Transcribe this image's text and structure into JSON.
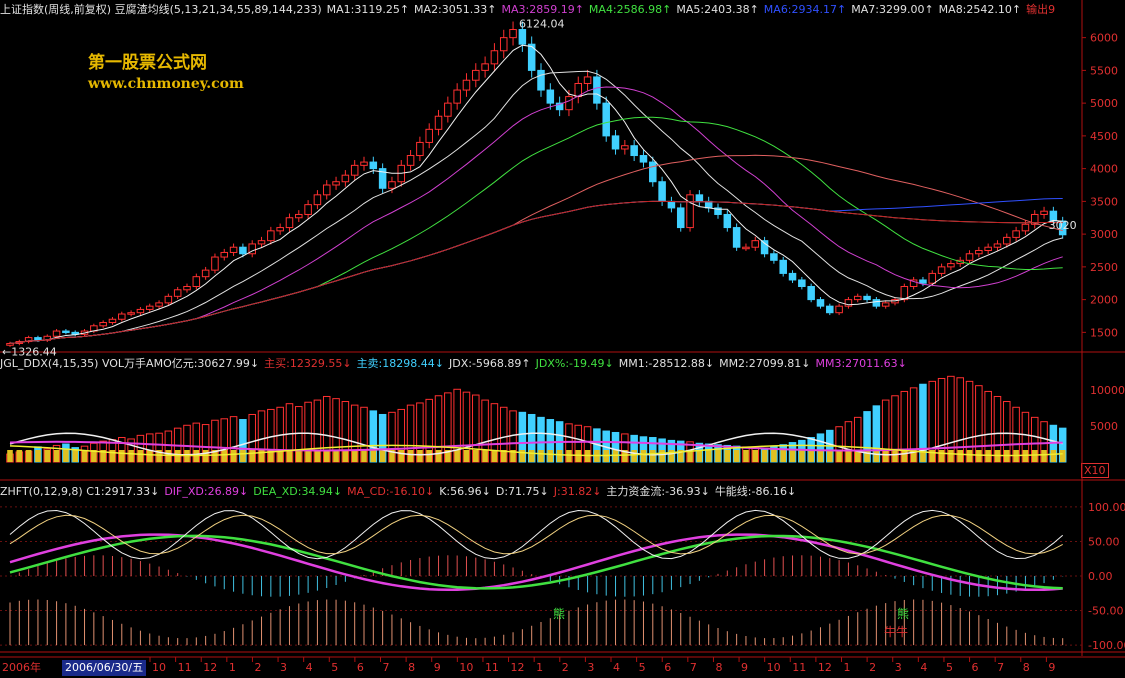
{
  "title_bar": {
    "items": [
      {
        "text": "上证指数(周线,前复权) 豆腐渣均线(5,13,21,34,55,89,144,233)",
        "color": "#e0e0e0"
      },
      {
        "text": "MA1:3119.25↑",
        "color": "#e0e0e0"
      },
      {
        "text": "MA2:3051.33↑",
        "color": "#e0e0e0"
      },
      {
        "text": "MA3:2859.19↑",
        "color": "#d040d0"
      },
      {
        "text": "MA4:2586.98↑",
        "color": "#40e040"
      },
      {
        "text": "MA5:2403.38↑",
        "color": "#e0e0e0"
      },
      {
        "text": "MA6:2934.17↑",
        "color": "#3050ff"
      },
      {
        "text": "MA7:3299.00↑",
        "color": "#e0e0e0"
      },
      {
        "text": "MA8:2542.10↑",
        "color": "#e0e0e0"
      },
      {
        "text": "输出9",
        "color": "#e03030"
      }
    ]
  },
  "watermark": {
    "line1": "第一股票公式网",
    "line2": "www.chnmoney.com"
  },
  "annotations": {
    "high": "6124.04",
    "low": "1326.44",
    "last": "3020"
  },
  "volume_bar": {
    "items": [
      {
        "text": "JGL_DDX(4,15,35) VOL万手AMO亿元:30627.99↓",
        "color": "#e0e0e0"
      },
      {
        "text": "主买:12329.55↓",
        "color": "#e03030"
      },
      {
        "text": "主卖:18298.44↓",
        "color": "#40d0ff"
      },
      {
        "text": "JDX:-5968.89↑",
        "color": "#e0e0e0"
      },
      {
        "text": "JDX%:-19.49↓",
        "color": "#40e040"
      },
      {
        "text": "MM1:-28512.88↓",
        "color": "#e0e0e0"
      },
      {
        "text": "MM2:27099.81↓",
        "color": "#e0e0e0"
      },
      {
        "text": "MM3:27011.63↓",
        "color": "#e040e0"
      }
    ]
  },
  "volume_scale": "X10",
  "indicator_bar": {
    "items": [
      {
        "text": "ZHFT(0,12,9,8) C1:2917.33↓",
        "color": "#e0e0e0"
      },
      {
        "text": "DIF_XD:26.89↓",
        "color": "#e040e0"
      },
      {
        "text": "DEA_XD:34.94↓",
        "color": "#40e040"
      },
      {
        "text": "MA_CD:-16.10↓",
        "color": "#e03030"
      },
      {
        "text": "K:56.96↓",
        "color": "#e0e0e0"
      },
      {
        "text": "D:71.75↓",
        "color": "#e0e0e0"
      },
      {
        "text": "J:31.82↓",
        "color": "#e03030"
      },
      {
        "text": "主力资金流:-36.93↓",
        "color": "#e0e0e0"
      },
      {
        "text": "牛能线:-86.16↓",
        "color": "#e0e0e0"
      }
    ]
  },
  "indicator_labels": {
    "bear1": "熊",
    "bear2": "熊",
    "bull": "牛牛"
  },
  "x_axis": {
    "year_label": "2006年",
    "cursor_date": "2006/06/30/五",
    "month_ticks": [
      "10",
      "11",
      "12",
      "1",
      "2",
      "3",
      "4",
      "5",
      "6",
      "7",
      "8",
      "9",
      "10",
      "11",
      "12",
      "1",
      "2",
      "3",
      "4",
      "5",
      "6",
      "7",
      "8",
      "9",
      "10",
      "11",
      "12",
      "1",
      "2",
      "3",
      "4",
      "5",
      "6",
      "7",
      "8",
      "9"
    ]
  },
  "chart_data": [
    {
      "type": "candlestick",
      "title": "上证指数(周线,前复权)",
      "ylim": [
        1200,
        6300
      ],
      "y_ticks": [
        1500,
        2000,
        2500,
        3000,
        3500,
        4000,
        4500,
        5000,
        5500,
        6000
      ],
      "close": [
        1330,
        1360,
        1420,
        1380,
        1440,
        1520,
        1500,
        1470,
        1520,
        1600,
        1650,
        1700,
        1780,
        1800,
        1850,
        1900,
        1950,
        2050,
        2150,
        2200,
        2350,
        2450,
        2650,
        2720,
        2800,
        2700,
        2850,
        2900,
        3050,
        3100,
        3250,
        3300,
        3450,
        3600,
        3750,
        3800,
        3900,
        4050,
        4100,
        4000,
        3700,
        3800,
        4050,
        4200,
        4400,
        4600,
        4800,
        5000,
        5200,
        5350,
        5500,
        5600,
        5800,
        6000,
        6124,
        5900,
        5500,
        5200,
        5000,
        4900,
        5100,
        5300,
        5400,
        5000,
        4500,
        4300,
        4350,
        4200,
        4100,
        3800,
        3500,
        3400,
        3100,
        3600,
        3500,
        3400,
        3300,
        3100,
        2800,
        2800,
        2900,
        2700,
        2600,
        2400,
        2300,
        2200,
        2000,
        1900,
        1800,
        1900,
        2000,
        2050,
        2000,
        1900,
        1950,
        2000,
        2200,
        2300,
        2250,
        2400,
        2500,
        2550,
        2600,
        2700,
        2750,
        2800,
        2850,
        2950,
        3050,
        3150,
        3300,
        3350,
        3200,
        2990
      ],
      "ma_periods": [
        5,
        13,
        21,
        34,
        55,
        89,
        144,
        233
      ]
    },
    {
      "type": "bar",
      "title": "JGL_DDX VOL",
      "ylim": [
        0,
        12500
      ],
      "y_ticks": [
        5000,
        10000
      ],
      "series": [
        {
          "name": "主买",
          "values": [
            1100,
            1400,
            1500,
            2100,
            1800,
            2300,
            2500,
            2000,
            2200,
            2600,
            2900,
            3100,
            3400,
            3200,
            3700,
            3900,
            4000,
            4300,
            4700,
            5100,
            5400,
            5200,
            5800,
            6000,
            6300,
            5900,
            6600,
            7100,
            7300,
            7600,
            8100,
            7700,
            8300,
            8600,
            9100,
            8800,
            8400,
            7900,
            7600,
            7100,
            6600,
            6900,
            7300,
            7900,
            8200,
            8700,
            9200,
            9600,
            10100,
            9700,
            9300,
            8600,
            8100,
            7600,
            7100,
            6900,
            6600,
            6200,
            5900,
            5600,
            5300,
            5100,
            4900,
            4600,
            4300,
            4100,
            3900,
            3700,
            3500,
            3400,
            3200,
            3000,
            2900,
            2800,
            2600,
            2500,
            2400,
            2300,
            2200,
            2100,
            2000,
            1900,
            2100,
            2400,
            2700,
            3000,
            3400,
            3900,
            4400,
            4900,
            5600,
            6200,
            7000,
            7800,
            8600,
            9200,
            9800,
            10300,
            10800,
            11200,
            11600,
            11900,
            11700,
            11200,
            10600,
            9800,
            9100,
            8400,
            7600,
            6900,
            6200,
            5600,
            5100,
            4700
          ]
        }
      ]
    },
    {
      "type": "line",
      "title": "ZHFT",
      "ylim": [
        -110,
        110
      ],
      "y_ticks": [
        -100,
        -50,
        0,
        50,
        100
      ]
    }
  ]
}
